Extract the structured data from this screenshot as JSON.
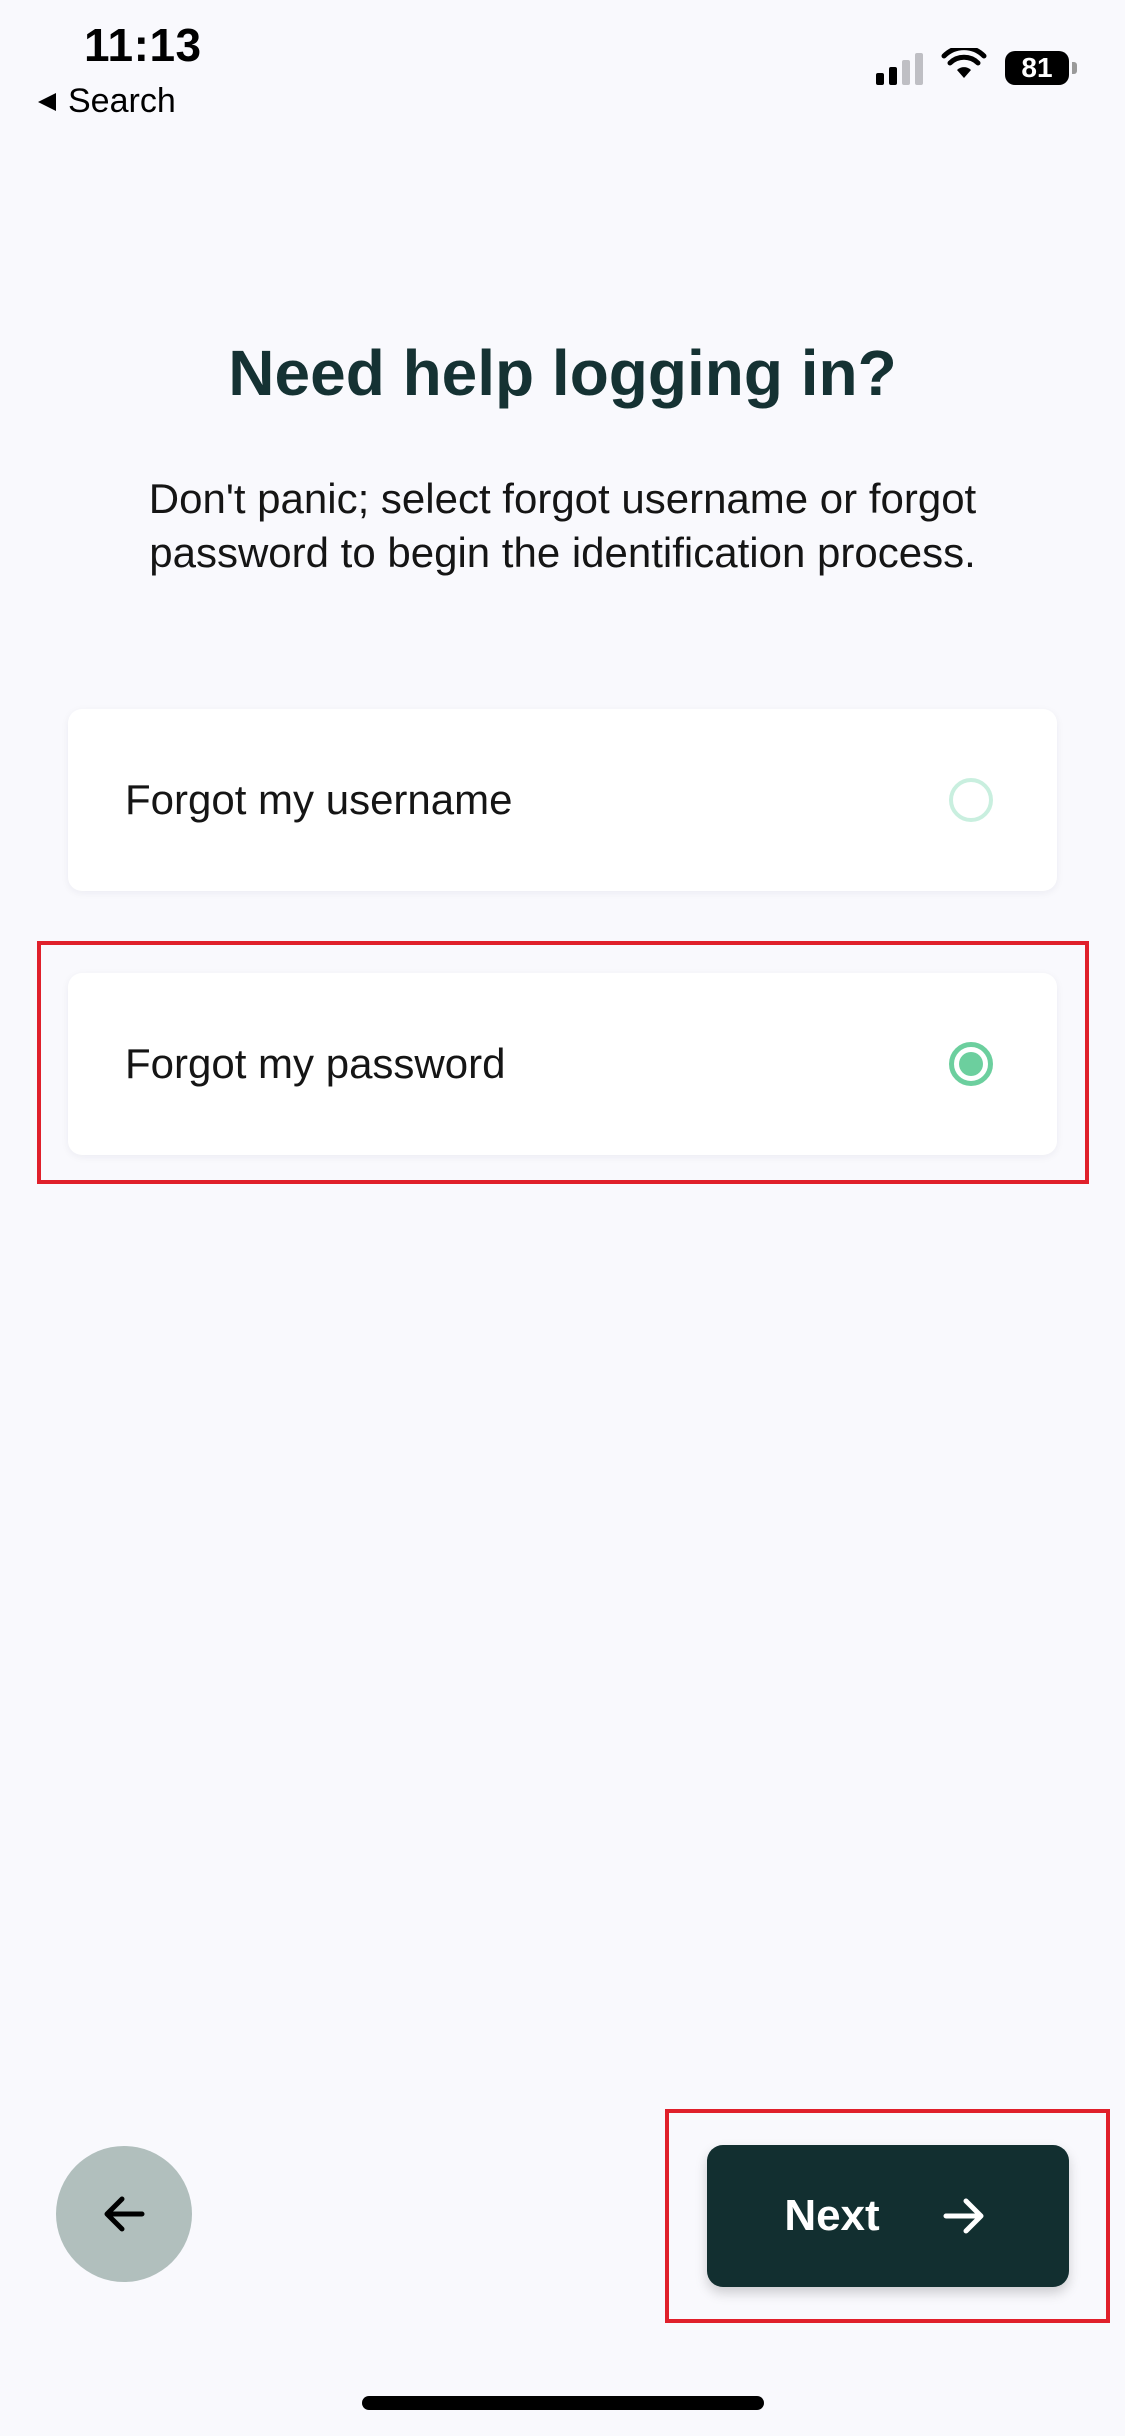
{
  "status_bar": {
    "time": "11:13",
    "back_app_label": "Search",
    "battery_level": "81",
    "signal_bars_on": 2,
    "signal_bars_total": 4
  },
  "page": {
    "title": "Need help logging in?",
    "description": "Don't panic; select forgot username or forgot password to begin the identification process."
  },
  "options": [
    {
      "label": "Forgot my username",
      "selected": false
    },
    {
      "label": "Forgot my password",
      "selected": true
    }
  ],
  "footer": {
    "back_icon": "arrow-left-icon",
    "next_label": "Next",
    "next_icon": "arrow-right-icon"
  },
  "colors": {
    "background": "#f9f9fd",
    "title": "#153233",
    "primary_button": "#122f30",
    "back_button": "#b1bfbd",
    "radio_selected": "#6ccf9e",
    "radio_unselected": "#c9efdf",
    "highlight": "#e0202b"
  }
}
